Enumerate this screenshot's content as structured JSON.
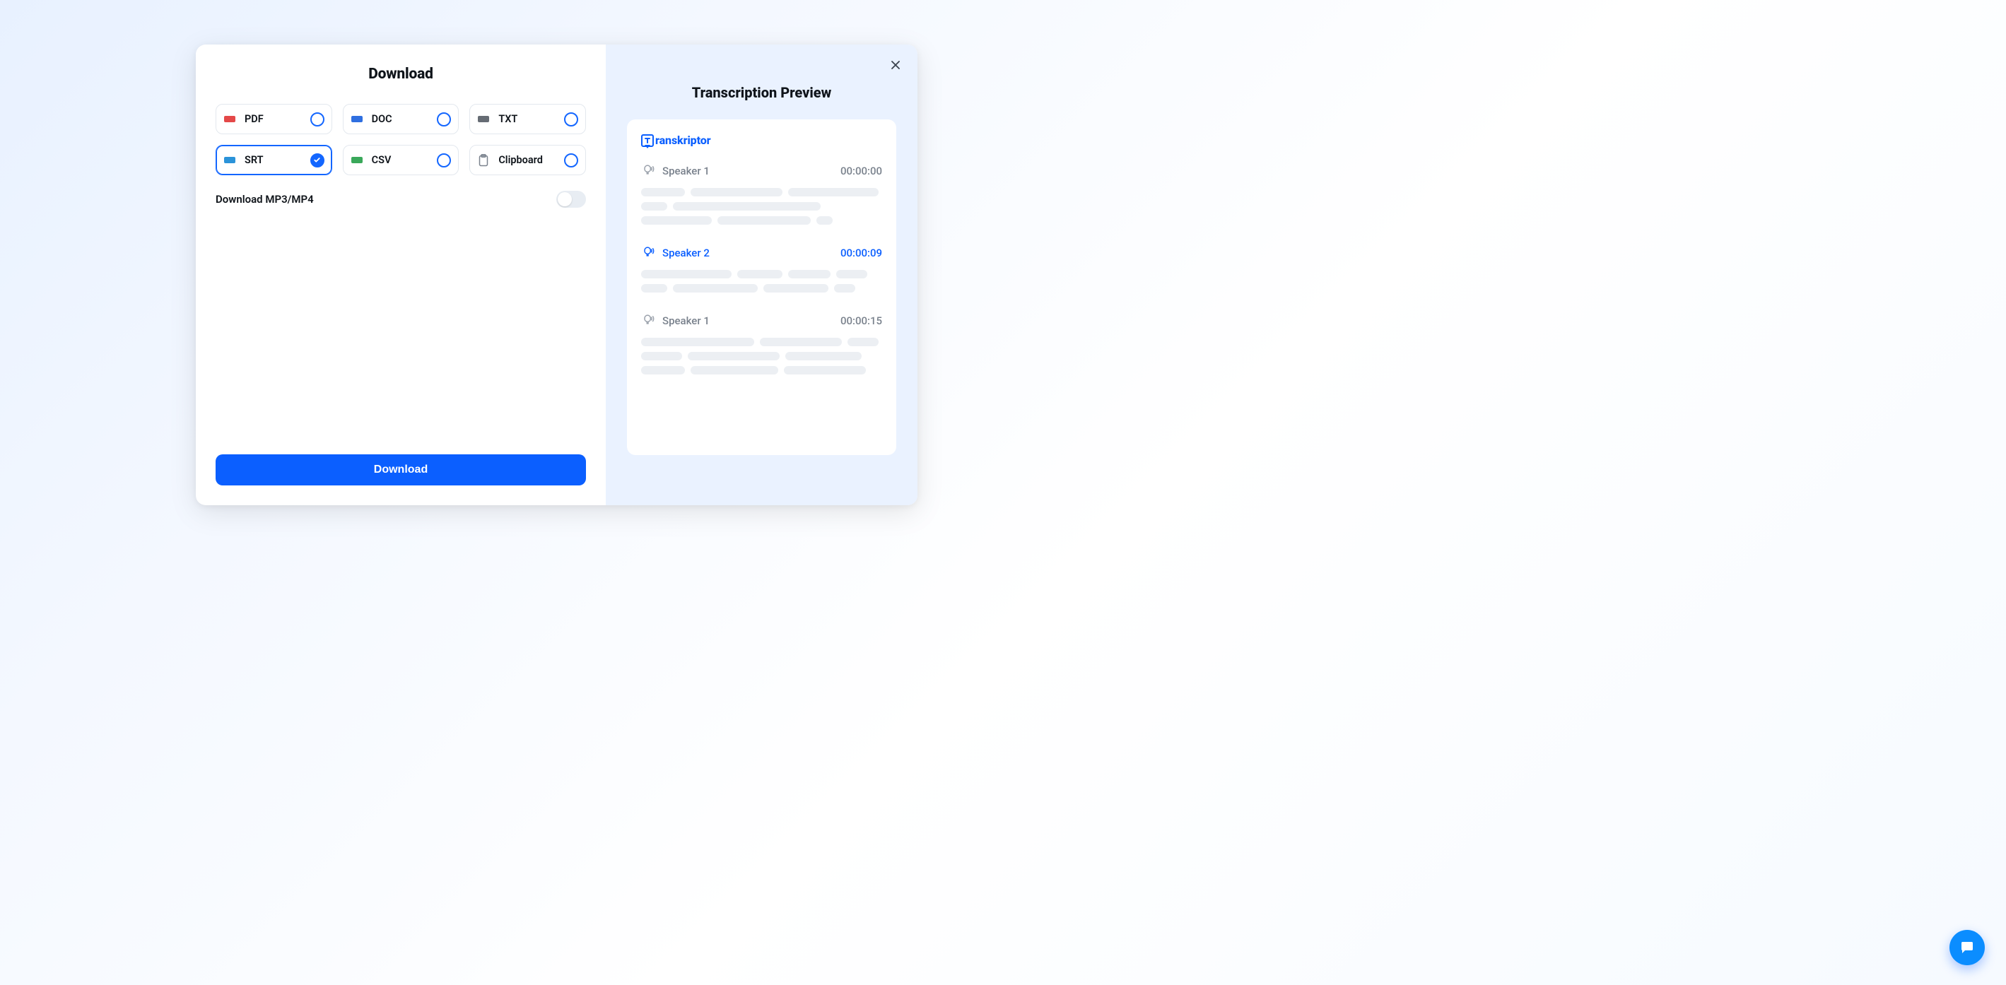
{
  "left": {
    "title": "Download",
    "formats": [
      {
        "id": "pdf",
        "label": "PDF",
        "icon": "pdf",
        "selected": false
      },
      {
        "id": "doc",
        "label": "DOC",
        "icon": "doc",
        "selected": false
      },
      {
        "id": "txt",
        "label": "TXT",
        "icon": "txt",
        "selected": false
      },
      {
        "id": "srt",
        "label": "SRT",
        "icon": "srt",
        "selected": true
      },
      {
        "id": "csv",
        "label": "CSV",
        "icon": "csv",
        "selected": false
      },
      {
        "id": "clipboard",
        "label": "Clipboard",
        "icon": "clipboard",
        "selected": false
      }
    ],
    "mp3_label": "Download MP3/MP4",
    "mp3_enabled": false,
    "download_button": "Download"
  },
  "right": {
    "title": "Transcription Preview",
    "brand": "ranskriptor",
    "segments": [
      {
        "speaker": "Speaker 1",
        "time": "00:00:00",
        "active": false,
        "line_widths": [
          62,
          130,
          128,
          37,
          209,
          100,
          132,
          23
        ]
      },
      {
        "speaker": "Speaker 2",
        "time": "00:00:09",
        "active": true,
        "line_widths": [
          128,
          64,
          60,
          44,
          37,
          120,
          92,
          30
        ]
      },
      {
        "speaker": "Speaker 1",
        "time": "00:00:15",
        "active": false,
        "line_widths": [
          160,
          116,
          44,
          58,
          130,
          108,
          62,
          124,
          116
        ]
      }
    ]
  },
  "chat_fab": "chat"
}
